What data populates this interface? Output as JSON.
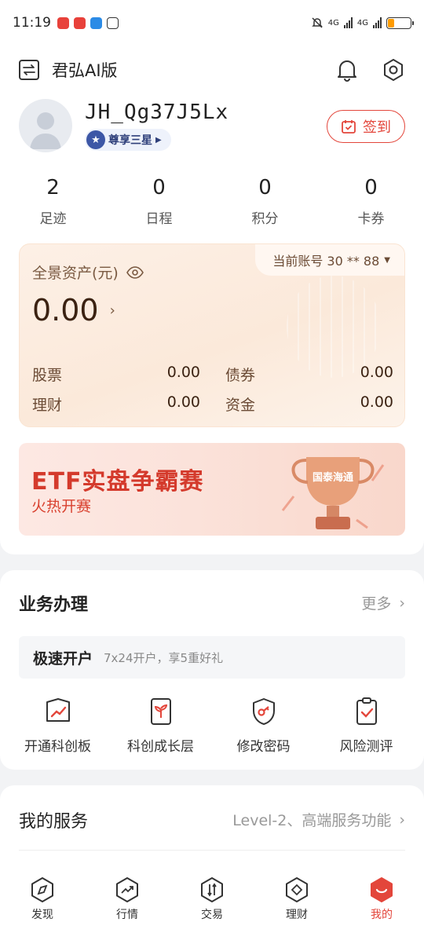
{
  "status_bar": {
    "time": "11:19",
    "network1": "4G",
    "network2": "4G"
  },
  "header": {
    "title": "君弘AI版"
  },
  "profile": {
    "username": "JH_Qg37J5Lx",
    "level": "尊享三星",
    "signin_label": "签到"
  },
  "stats": [
    {
      "value": "2",
      "label": "足迹"
    },
    {
      "value": "0",
      "label": "日程"
    },
    {
      "value": "0",
      "label": "积分"
    },
    {
      "value": "0",
      "label": "卡券"
    }
  ],
  "assets": {
    "title": "全景资产(元)",
    "account_label": "当前账号 30 ** 88",
    "total": "0.00",
    "items": [
      {
        "label": "股票",
        "value": "0.00"
      },
      {
        "label": "债券",
        "value": "0.00"
      },
      {
        "label": "理财",
        "value": "0.00"
      },
      {
        "label": "资金",
        "value": "0.00"
      }
    ]
  },
  "banner": {
    "title": "ETF实盘争霸赛",
    "subtitle": "火热开赛",
    "trophy_text": "国泰海通"
  },
  "business": {
    "title": "业务办理",
    "more": "更多",
    "fast_open_title": "极速开户",
    "fast_open_sub": "7x24开户，享5重好礼",
    "items": [
      {
        "label": "开通科创板",
        "icon": "chart-board-icon"
      },
      {
        "label": "科创成长层",
        "icon": "growth-sprout-icon"
      },
      {
        "label": "修改密码",
        "icon": "key-shield-icon"
      },
      {
        "label": "风险测评",
        "icon": "clipboard-check-icon"
      }
    ]
  },
  "service": {
    "title": "我的服务",
    "more": "Level-2、高端服务功能"
  },
  "tabbar": [
    {
      "label": "发现",
      "icon": "compass-icon"
    },
    {
      "label": "行情",
      "icon": "trend-icon"
    },
    {
      "label": "交易",
      "icon": "exchange-icon"
    },
    {
      "label": "理财",
      "icon": "wealth-icon"
    },
    {
      "label": "我的",
      "icon": "smile-icon",
      "active": true
    }
  ],
  "colors": {
    "accent": "#e3463b",
    "asset_text": "#3b2212"
  }
}
